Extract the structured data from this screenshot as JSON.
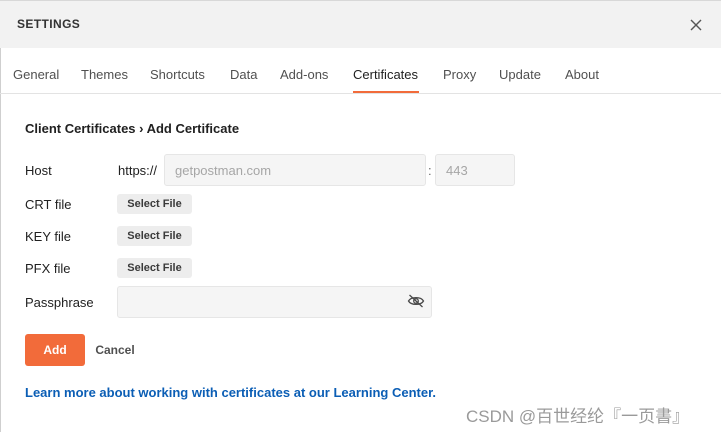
{
  "dialog": {
    "title": "SETTINGS",
    "close_icon": "close-icon"
  },
  "tabs": [
    {
      "label": "General",
      "active": false
    },
    {
      "label": "Themes",
      "active": false
    },
    {
      "label": "Shortcuts",
      "active": false
    },
    {
      "label": "Data",
      "active": false
    },
    {
      "label": "Add-ons",
      "active": false
    },
    {
      "label": "Certificates",
      "active": true
    },
    {
      "label": "Proxy",
      "active": false
    },
    {
      "label": "Update",
      "active": false
    },
    {
      "label": "About",
      "active": false
    }
  ],
  "breadcrumb": "Client Certificates › Add Certificate",
  "form": {
    "host_label": "Host",
    "host_prefix": "https://",
    "host_value": "",
    "host_placeholder": "getpostman.com",
    "port_separator": ":",
    "port_value": "",
    "port_placeholder": "443",
    "crt_label": "CRT file",
    "key_label": "KEY file",
    "pfx_label": "PFX file",
    "select_file_label": "Select File",
    "passphrase_label": "Passphrase",
    "passphrase_value": "",
    "passphrase_icon": "eye-slash-icon"
  },
  "actions": {
    "add_label": "Add",
    "cancel_label": "Cancel"
  },
  "learn_link": "Learn more about working with certificates at our Learning Center.",
  "watermark": "CSDN @百世经纶『一页書』",
  "colors": {
    "accent": "#f26b3a",
    "link": "#0b5eb5",
    "header_bg": "#f2f2f2"
  }
}
